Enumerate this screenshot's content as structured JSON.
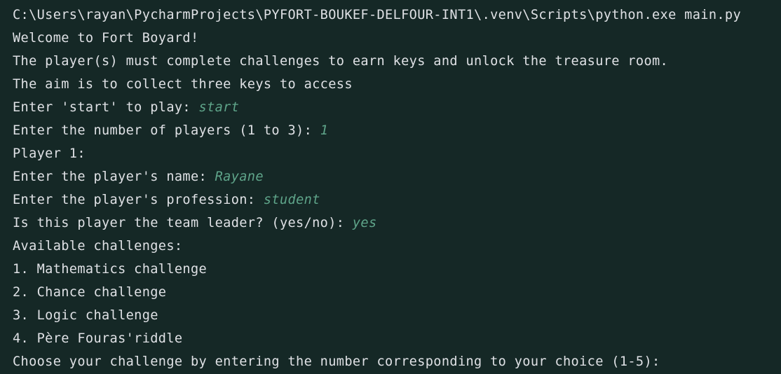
{
  "console": {
    "command_line": "C:\\Users\\rayan\\PycharmProjects\\PYFORT-BOUKEF-DELFOUR-INT1\\.venv\\Scripts\\python.exe main.py",
    "welcome": "Welcome to Fort Boyard!",
    "intro_1": "The player(s) must complete challenges to earn keys and unlock the treasure room.",
    "intro_2": "The aim is to collect three keys to access",
    "prompt_start": "Enter 'start' to play: ",
    "input_start": "start",
    "prompt_players": "Enter the number of players (1 to 3): ",
    "input_players": "1",
    "player_header": "Player 1:",
    "prompt_name": "Enter the player's name: ",
    "input_name": "Rayane",
    "prompt_profession": "Enter the player's profession: ",
    "input_profession": "student",
    "prompt_leader": "Is this player the team leader? (yes/no): ",
    "input_leader": "yes",
    "challenges_header": "Available challenges:",
    "challenges": [
      "1. Mathematics challenge",
      "2. Chance challenge",
      "3. Logic challenge",
      "4. Père Fouras'riddle"
    ],
    "prompt_choice": "Choose your challenge by entering the number corresponding to your choice (1-5):"
  },
  "colors": {
    "background": "#152826",
    "output_text": "#dfe1e5",
    "user_input": "#5fa58a"
  }
}
